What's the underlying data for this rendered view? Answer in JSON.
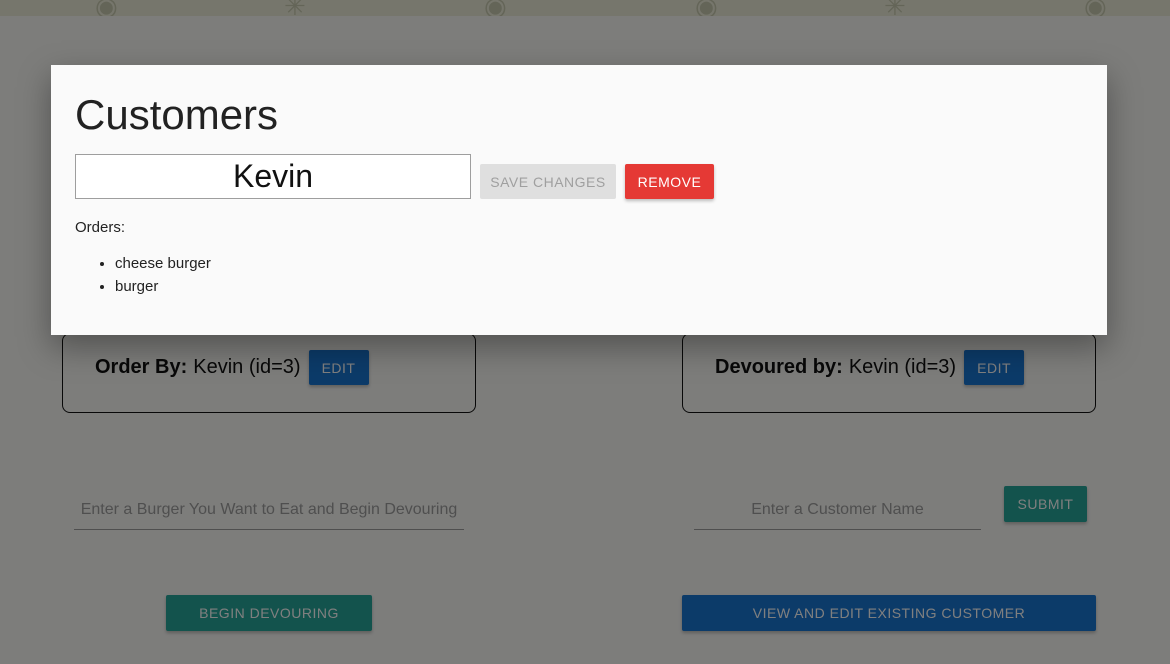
{
  "background": {
    "order_card": {
      "label": "Order By:",
      "value": "Kevin (id=3)",
      "edit_label": "EDIT"
    },
    "devour_card": {
      "label": "Devoured by:",
      "value": "Kevin (id=3)",
      "edit_label": "EDIT"
    },
    "burger_input": {
      "placeholder": "Enter a Burger You Want to Eat and Begin Devouring"
    },
    "customer_input": {
      "placeholder": "Enter a Customer Name"
    },
    "submit_label": "SUBMIT",
    "begin_label": "BEGIN DEVOURING",
    "view_edit_label": "VIEW AND EDIT EXISTING CUSTOMER"
  },
  "modal": {
    "title": "Customers",
    "name_value": "Kevin",
    "save_label": "SAVE CHANGES",
    "remove_label": "REMOVE",
    "orders_label": "Orders:",
    "orders": [
      "cheese burger",
      "burger"
    ]
  },
  "colors": {
    "primary_blue": "#1976d2",
    "teal": "#26a69a",
    "remove_red": "#e53935",
    "overlay": "rgba(0,0,0,0.5)"
  }
}
